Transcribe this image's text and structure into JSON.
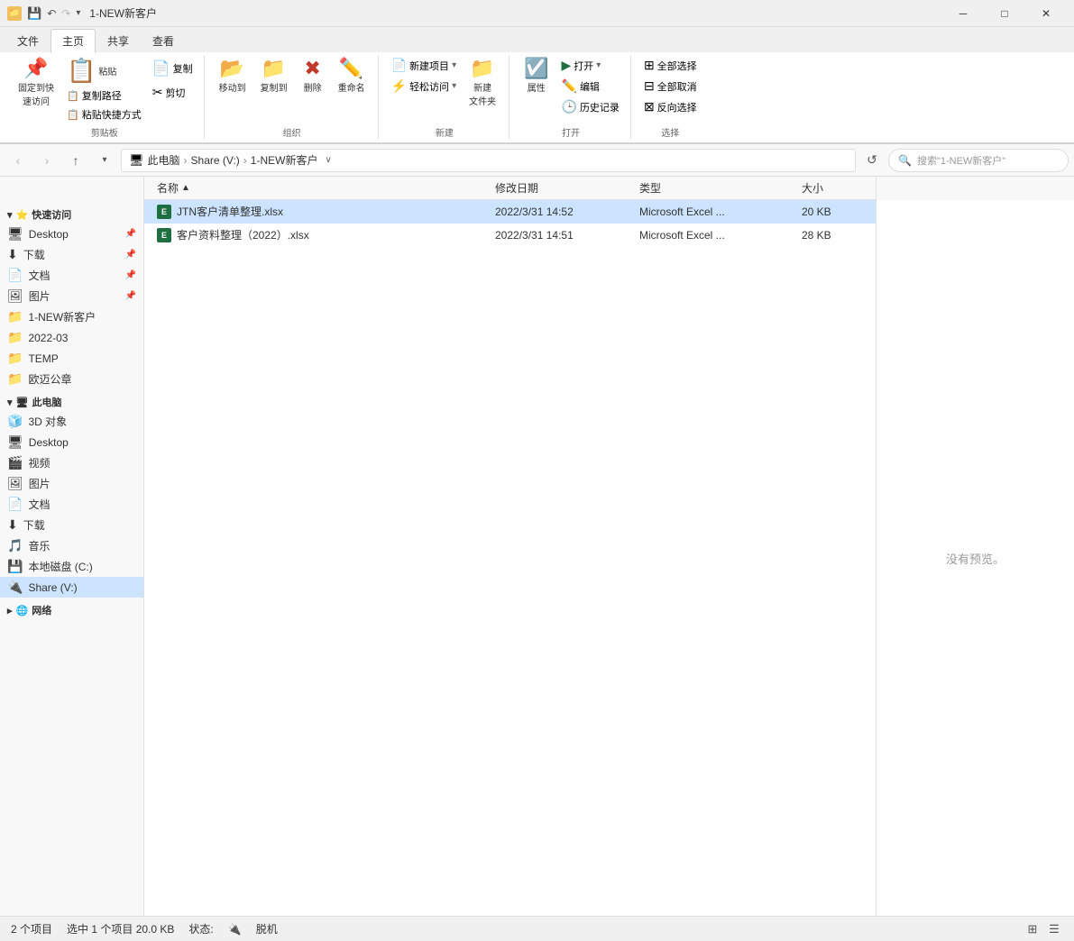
{
  "window": {
    "title": "1-NEW新客户",
    "min_btn": "─",
    "max_btn": "□",
    "close_btn": "✕"
  },
  "ribbon": {
    "tabs": [
      "文件",
      "主页",
      "共享",
      "查看"
    ],
    "active_tab": "主页",
    "groups": {
      "clipboard": {
        "label": "剪贴板",
        "pin_btn": "固定到快\n速访问",
        "copy_btn": "复制",
        "paste_btn": "粘贴",
        "paste_path_btn": "复制路径",
        "paste_shortcut_btn": "粘贴快捷方式",
        "cut_btn": "✂ 剪切"
      },
      "organize": {
        "label": "组织",
        "move_btn": "移动到",
        "copy_btn": "复制到",
        "delete_btn": "删除",
        "rename_btn": "重命名"
      },
      "new": {
        "label": "新建",
        "new_item_btn": "新建项目",
        "easy_access_btn": "轻松访问",
        "new_folder_btn": "新建\n文件夹"
      },
      "open": {
        "label": "打开",
        "properties_btn": "属性",
        "open_btn": "打开",
        "edit_btn": "编辑",
        "history_btn": "历史记录"
      },
      "select": {
        "label": "选择",
        "select_all_btn": "全部选择",
        "select_none_btn": "全部取消",
        "invert_btn": "反向选择"
      }
    }
  },
  "addressbar": {
    "back_tooltip": "后退",
    "forward_tooltip": "前进",
    "up_tooltip": "向上",
    "path": {
      "pc": "此电脑",
      "sep1": "›",
      "share": "Share (V:)",
      "sep2": "›",
      "folder": "1-NEW新客户"
    },
    "dropdown_arrow": "∨",
    "refresh_tooltip": "刷新",
    "search_placeholder": "搜索\"1-NEW新客户\""
  },
  "sidebar": {
    "quick_access": {
      "label": "快速访问",
      "items": [
        {
          "name": "Desktop",
          "icon": "🖥",
          "pinned": true
        },
        {
          "name": "下载",
          "icon": "⬇",
          "pinned": true
        },
        {
          "name": "文档",
          "icon": "📄",
          "pinned": true
        },
        {
          "name": "图片",
          "icon": "🖼",
          "pinned": true
        },
        {
          "name": "1-NEW新客户",
          "icon": "📁",
          "pinned": false
        },
        {
          "name": "2022-03",
          "icon": "📁",
          "pinned": false
        },
        {
          "name": "TEMP",
          "icon": "📁",
          "pinned": false
        },
        {
          "name": "欧迈公章",
          "icon": "📁",
          "pinned": false
        }
      ]
    },
    "this_pc": {
      "label": "此电脑",
      "items": [
        {
          "name": "3D 对象",
          "icon": "🧊"
        },
        {
          "name": "Desktop",
          "icon": "🖥"
        },
        {
          "name": "视频",
          "icon": "🎬"
        },
        {
          "name": "图片",
          "icon": "🖼"
        },
        {
          "name": "文档",
          "icon": "📄"
        },
        {
          "name": "下载",
          "icon": "⬇"
        },
        {
          "name": "音乐",
          "icon": "🎵"
        },
        {
          "name": "本地磁盘 (C:)",
          "icon": "💾"
        },
        {
          "name": "Share (V:)",
          "icon": "🔌",
          "selected": true
        }
      ]
    },
    "network": {
      "label": "网络",
      "icon": "🌐"
    }
  },
  "file_list": {
    "columns": [
      "名称",
      "修改日期",
      "类型",
      "大小"
    ],
    "sort_col": "名称",
    "sort_dir": "asc",
    "files": [
      {
        "name": "JTN客户清单整理.xlsx",
        "date": "2022/3/31 14:52",
        "type": "Microsoft Excel ...",
        "size": "20 KB",
        "selected": true
      },
      {
        "name": "客户资料整理（2022）.xlsx",
        "date": "2022/3/31 14:51",
        "type": "Microsoft Excel ...",
        "size": "28 KB",
        "selected": false
      }
    ]
  },
  "preview": {
    "no_preview_text": "没有预览。"
  },
  "status_bar": {
    "total_items": "2 个项目",
    "selected_info": "选中 1 个项目  20.0 KB",
    "status_label": "状态:",
    "status_icon": "🔌",
    "status_text": "脱机",
    "view_icons": [
      "⊞",
      "☰"
    ]
  }
}
